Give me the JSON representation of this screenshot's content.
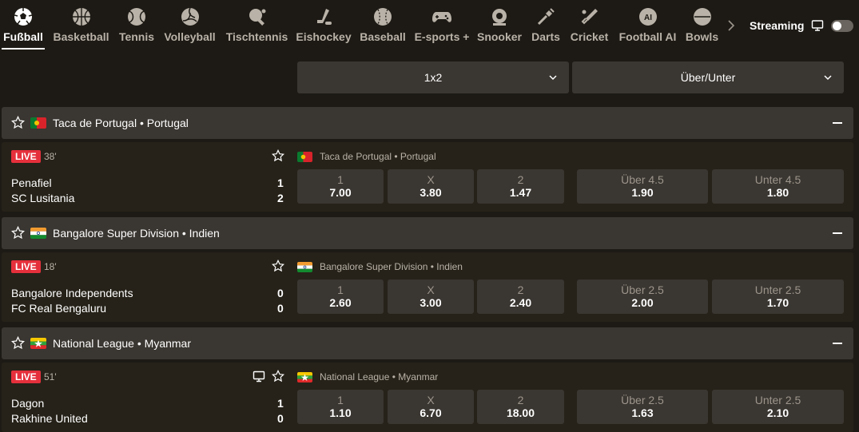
{
  "sports_nav": [
    {
      "label": "Fußball",
      "icon": "soccer-ball-icon",
      "active": true
    },
    {
      "label": "Basketball",
      "icon": "basketball-icon",
      "active": false
    },
    {
      "label": "Tennis",
      "icon": "tennis-ball-icon",
      "active": false
    },
    {
      "label": "Volleyball",
      "icon": "volleyball-icon",
      "active": false
    },
    {
      "label": "Tischtennis",
      "icon": "table-tennis-icon",
      "active": false
    },
    {
      "label": "Eishockey",
      "icon": "ice-hockey-icon",
      "active": false
    },
    {
      "label": "Baseball",
      "icon": "baseball-icon",
      "active": false
    },
    {
      "label": "E-sports +",
      "icon": "gamepad-icon",
      "active": false
    },
    {
      "label": "Snooker",
      "icon": "snooker-icon",
      "active": false
    },
    {
      "label": "Darts",
      "icon": "darts-icon",
      "active": false
    },
    {
      "label": "Cricket",
      "icon": "cricket-icon",
      "active": false
    },
    {
      "label": "Football AI",
      "icon": "football-ai-icon",
      "active": false
    },
    {
      "label": "Bowls",
      "icon": "bowls-icon",
      "active": false
    }
  ],
  "streaming": {
    "label": "Streaming",
    "enabled": false
  },
  "markets": {
    "primary": "1x2",
    "secondary": "Über/Unter"
  },
  "colors": {
    "background": "#1d1a15",
    "panel": "#3a3631",
    "card": "#262219",
    "live_badge": "#e5303c",
    "muted_text": "#b9b2a8"
  },
  "leagues": [
    {
      "title": "Taca de Portugal • Portugal",
      "flag": "portugal",
      "match": {
        "live_label": "LIVE",
        "minute": "38'",
        "has_stream": false,
        "league_label": "Taca de Portugal • Portugal",
        "home": "Penafiel",
        "away": "SC Lusitania",
        "home_score": "1",
        "away_score": "2",
        "odds_1x2": [
          {
            "label": "1",
            "value": "7.00"
          },
          {
            "label": "X",
            "value": "3.80"
          },
          {
            "label": "2",
            "value": "1.47"
          }
        ],
        "odds_ou": [
          {
            "label": "Über 4.5",
            "value": "1.90"
          },
          {
            "label": "Unter 4.5",
            "value": "1.80"
          }
        ]
      }
    },
    {
      "title": "Bangalore Super Division • Indien",
      "flag": "india",
      "match": {
        "live_label": "LIVE",
        "minute": "18'",
        "has_stream": false,
        "league_label": "Bangalore Super Division • Indien",
        "home": "Bangalore Independents",
        "away": "FC Real Bengaluru",
        "home_score": "0",
        "away_score": "0",
        "odds_1x2": [
          {
            "label": "1",
            "value": "2.60"
          },
          {
            "label": "X",
            "value": "3.00"
          },
          {
            "label": "2",
            "value": "2.40"
          }
        ],
        "odds_ou": [
          {
            "label": "Über 2.5",
            "value": "2.00"
          },
          {
            "label": "Unter 2.5",
            "value": "1.70"
          }
        ]
      }
    },
    {
      "title": "National League • Myanmar",
      "flag": "myanmar",
      "match": {
        "live_label": "LIVE",
        "minute": "51'",
        "has_stream": true,
        "league_label": "National League • Myanmar",
        "home": "Dagon",
        "away": "Rakhine United",
        "home_score": "1",
        "away_score": "0",
        "odds_1x2": [
          {
            "label": "1",
            "value": "1.10"
          },
          {
            "label": "X",
            "value": "6.70"
          },
          {
            "label": "2",
            "value": "18.00"
          }
        ],
        "odds_ou": [
          {
            "label": "Über 2.5",
            "value": "1.63"
          },
          {
            "label": "Unter 2.5",
            "value": "2.10"
          }
        ]
      }
    }
  ]
}
